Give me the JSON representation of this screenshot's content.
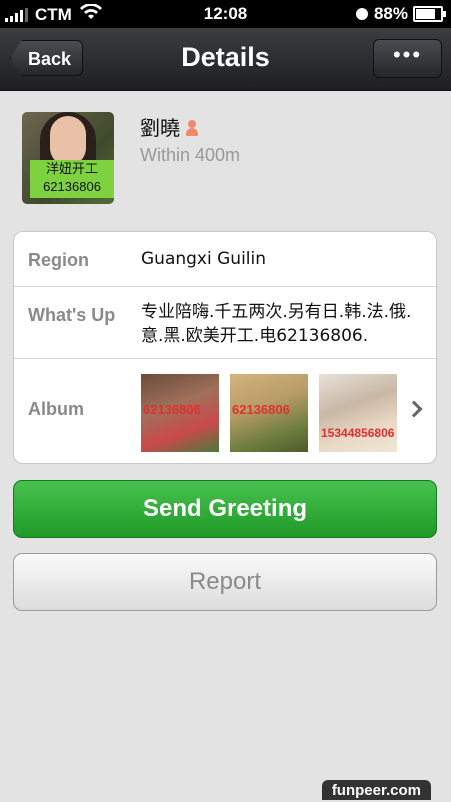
{
  "status_bar": {
    "carrier": "CTM",
    "time": "12:08",
    "battery": "88%",
    "battery_level": 0.88
  },
  "nav": {
    "back_label": "Back",
    "title": "Details",
    "more_label": "•••"
  },
  "profile": {
    "avatar_caption_line1": "洋妞开工",
    "avatar_caption_line2": "62136806",
    "name": "劉曉",
    "gender_icon": "female-icon",
    "distance": "Within 400m"
  },
  "info": {
    "region_label": "Region",
    "region_value": "Guangxi Guilin",
    "whatsup_label": "What's Up",
    "whatsup_value": "专业陪嗨.千五两次.另有日.韩.法.俄.意.黑.欧美开工.电62136806.",
    "album_label": "Album",
    "album_watermarks": [
      "62136806",
      "62136806",
      "15344856806"
    ]
  },
  "actions": {
    "send_greeting": "Send Greeting",
    "report": "Report"
  },
  "colors": {
    "accent_green": "#2aa832",
    "nav_dark": "#2a2b2e",
    "background": "#e3e3e3"
  },
  "watermark": "funpeer.com"
}
